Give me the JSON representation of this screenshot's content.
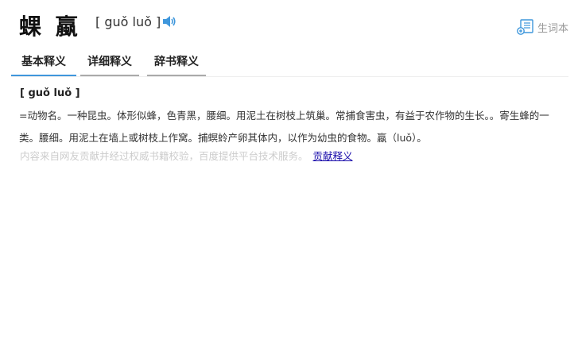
{
  "header": {
    "word": "蜾 蠃",
    "pinyin": "[ guǒ luǒ ]",
    "audio_icon": "speaker-icon",
    "vocab_label": "生词本",
    "vocab_icon": "vocab-book-icon"
  },
  "tabs": [
    {
      "label": "基本释义",
      "active": true
    },
    {
      "label": "详细释义",
      "active": false
    },
    {
      "label": "辞书释义",
      "active": false
    }
  ],
  "definition": {
    "pinyin": "[ guǒ luǒ ]",
    "text": "=动物名。一种昆虫。体形似蜂，色青黑，腰细。用泥土在树枝上筑巢。常捕食害虫，有益于农作物的生长。。寄生蜂的一类。腰细。用泥土在墙上或树枝上作窝。捕螟蛉产卵其体内，以作为幼虫的食物。蠃（luǒ）。"
  },
  "footer": {
    "source_text": "内容来自网友贡献并经过权威书籍校验，百度提供平台技术服务。",
    "contribute_link": "贡献释义"
  },
  "colors": {
    "accent": "#3f97dc",
    "link": "#1a0dab",
    "muted": "#cccccc"
  }
}
